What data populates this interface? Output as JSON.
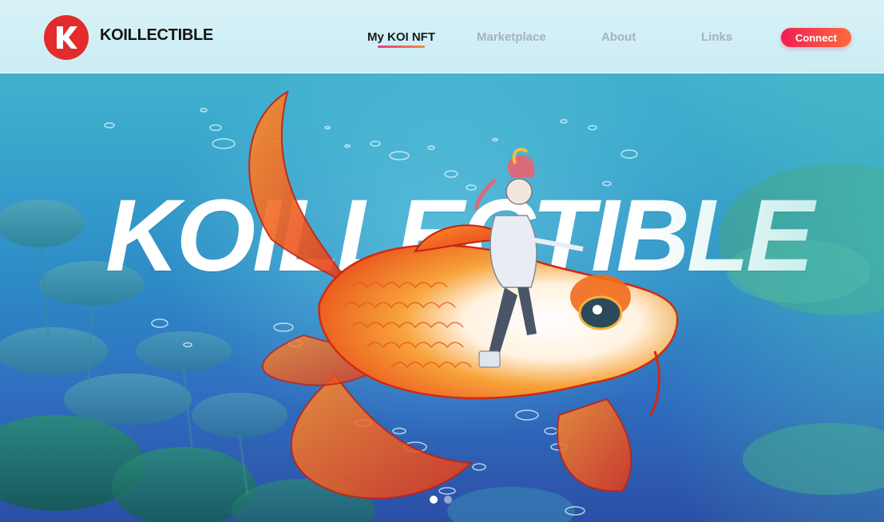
{
  "brand": {
    "name": "KOILLECTIBLE",
    "logo_letter": "K"
  },
  "nav": {
    "items": [
      {
        "label": "My KOI NFT",
        "active": true
      },
      {
        "label": "Marketplace",
        "active": false
      },
      {
        "label": "About",
        "active": false
      },
      {
        "label": "Links",
        "active": false
      }
    ],
    "connect_label": "Connect"
  },
  "hero": {
    "title": "KOILLECTIBLE",
    "illustration": "girl-riding-koi-fish-underwater",
    "slides_total": 2,
    "slide_active": 1
  },
  "colors": {
    "accent": "#f01e54",
    "accent_end": "#ff6a3c",
    "logo_red": "#e32b2b",
    "water_top": "#4bb9d2",
    "water_bottom": "#2c4fa6",
    "koi_orange": "#f26a1b"
  }
}
